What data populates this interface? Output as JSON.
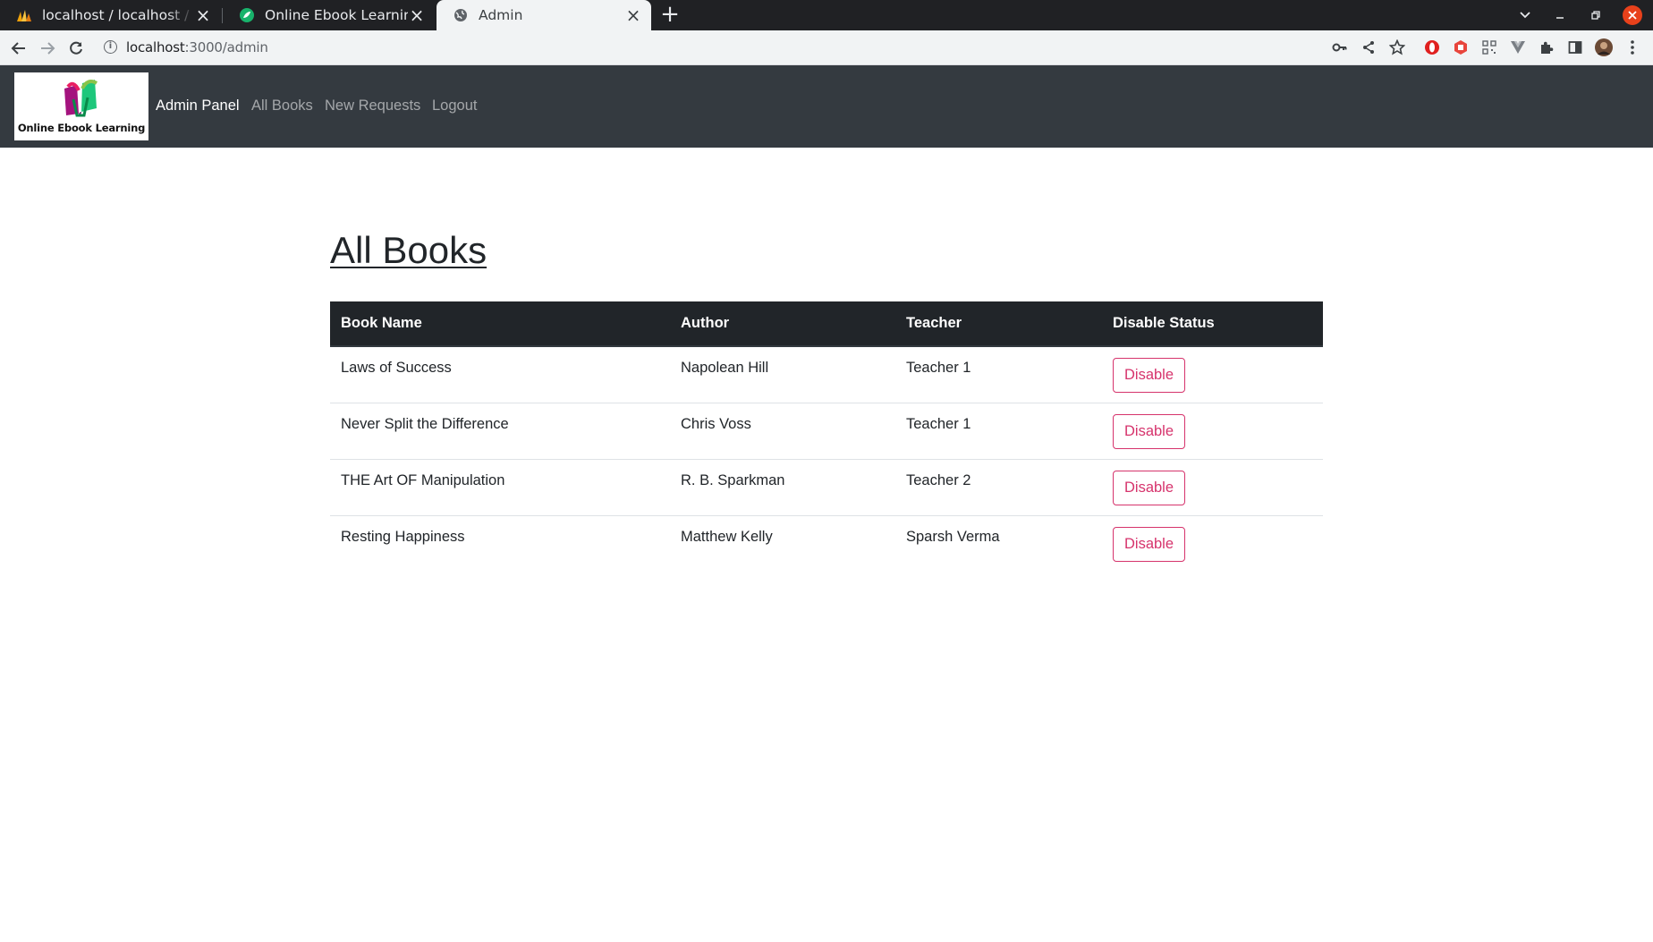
{
  "browser": {
    "tabs": [
      {
        "title": "localhost / localhost / Online Ebook",
        "favicon": "phpmyadmin-icon",
        "active": false
      },
      {
        "title": "Online Ebook Learning",
        "favicon": "leaf-icon",
        "active": false
      },
      {
        "title": "Admin",
        "favicon": "globe-icon",
        "active": true
      }
    ],
    "new_tab_label": "+",
    "close_tab_glyph": "×",
    "url_host": "localhost",
    "url_path": ":3000/admin"
  },
  "navbar": {
    "logo_text": "Online Ebook Learning",
    "brand": "Admin Panel",
    "links": [
      "All Books",
      "New Requests",
      "Logout"
    ],
    "background": "#343a40"
  },
  "main": {
    "title": "All Books",
    "table": {
      "headers": [
        "Book Name",
        "Author",
        "Teacher",
        "Disable Status"
      ],
      "rows": [
        {
          "book": "Laws of Success",
          "author": "Napolean Hill",
          "teacher": "Teacher 1",
          "action": "Disable"
        },
        {
          "book": "Never Split the Difference",
          "author": "Chris Voss",
          "teacher": "Teacher 1",
          "action": "Disable"
        },
        {
          "book": "THE Art OF Manipulation",
          "author": "R. B. Sparkman",
          "teacher": "Teacher 2",
          "action": "Disable"
        },
        {
          "book": "Resting Happiness",
          "author": "Matthew Kelly",
          "teacher": "Sparsh Verma",
          "action": "Disable"
        }
      ]
    },
    "button_color": "#d6336c"
  }
}
